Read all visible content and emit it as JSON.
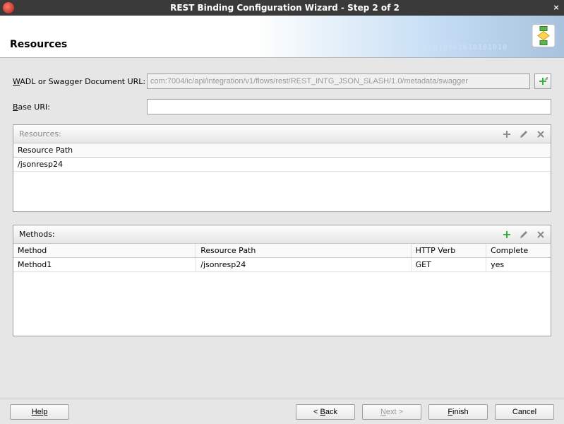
{
  "window": {
    "title": "REST Binding Configuration Wizard - Step 2 of 2"
  },
  "header": {
    "title": "Resources",
    "binary_decor": "01010101010101010101010"
  },
  "form": {
    "wadl_label_pre": "W",
    "wadl_label_rest": "ADL or Swagger Document URL:",
    "wadl_value": "com:7004/ic/api/integration/v1/flows/rest/REST_INTG_JSON_SLASH/1.0/metadata/swagger",
    "base_label_pre": "B",
    "base_label_rest": "ase URI:",
    "base_value": ""
  },
  "resources_panel": {
    "label_pre": "R",
    "label_rest": "esources:",
    "columns": {
      "path": "Resource Path"
    },
    "rows": [
      {
        "path": "/jsonresp24"
      }
    ]
  },
  "methods_panel": {
    "label": "Methods:",
    "columns": {
      "method": "Method",
      "path": "Resource Path",
      "verb": "HTTP Verb",
      "complete": "Complete"
    },
    "rows": [
      {
        "method": "Method1",
        "path": "/jsonresp24",
        "verb": "GET",
        "complete": "yes"
      }
    ]
  },
  "footer": {
    "help": "Help",
    "back": "< Back",
    "next": "Next >",
    "finish": "Finish",
    "cancel": "Cancel"
  },
  "icons": {
    "plus_gray": "#8b8b8b",
    "plus_green": "#2fb53b",
    "pencil": "#8b8b8b",
    "delete": "#8b8b8b"
  }
}
